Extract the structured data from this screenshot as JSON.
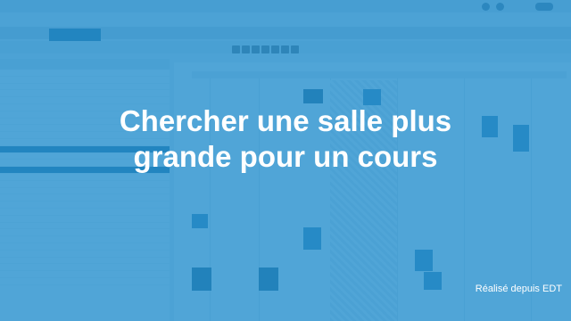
{
  "overlay": {
    "title_line1": "Chercher une salle plus",
    "title_line2": "grande pour un cours",
    "credit": "Réalisé depuis EDT"
  },
  "colors": {
    "overlay": "#248ecd",
    "accent_dark": "#1d5f8a"
  }
}
